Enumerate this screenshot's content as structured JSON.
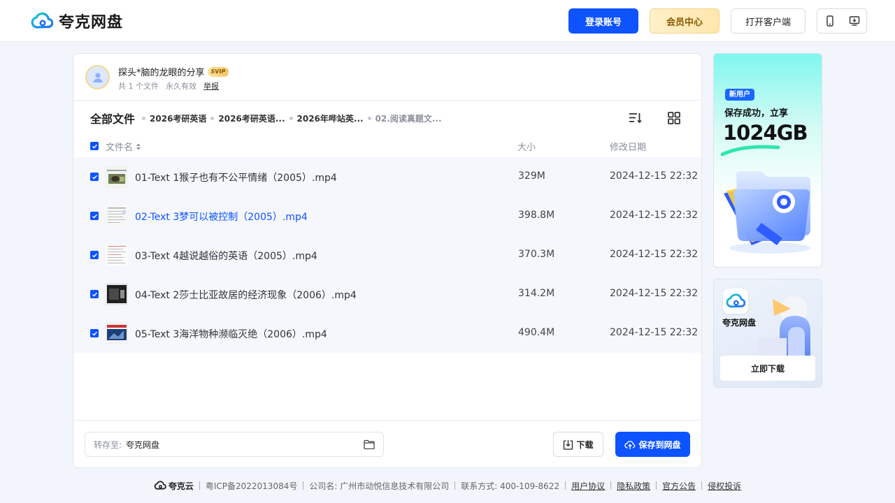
{
  "header": {
    "logo_text": "夸克网盘",
    "login_label": "登录账号",
    "vip_label": "会员中心",
    "client_label": "打开客户端"
  },
  "share": {
    "title": "探头*脑的龙眼的分享",
    "badge": "SVIP",
    "file_count": "共 1 个文件",
    "validity": "永久有效",
    "report": "举报"
  },
  "breadcrumb": {
    "root": "全部文件",
    "items": [
      "2026考研英语",
      "2026考研英语...",
      "2026年哔站英...",
      "02.阅读真题文..."
    ]
  },
  "columns": {
    "name": "文件名",
    "size": "大小",
    "date": "修改日期"
  },
  "files": [
    {
      "name": "01-Text 1猴子也有不公平情绪（2005）.mp4",
      "size": "329M",
      "date": "2024-12-15 22:32"
    },
    {
      "name": "02-Text 3梦可以被控制（2005）.mp4",
      "size": "398.8M",
      "date": "2024-12-15 22:32"
    },
    {
      "name": "03-Text 4越说越俗的英语（2005）.mp4",
      "size": "370.3M",
      "date": "2024-12-15 22:32"
    },
    {
      "name": "04-Text 2莎士比亚故居的经济现象（2006）.mp4",
      "size": "314.2M",
      "date": "2024-12-15 22:32"
    },
    {
      "name": "05-Text 3海洋物种濒临灭绝（2006）.mp4",
      "size": "490.4M",
      "date": "2024-12-15 22:32"
    }
  ],
  "save_bar": {
    "label": "转存至:",
    "value": "夸克网盘",
    "download": "下载",
    "save": "保存到网盘"
  },
  "ads": {
    "ad1_badge": "新用户",
    "ad1_line1": "保存成功，立享",
    "ad1_big": "1024GB",
    "ad2_name": "夸克网盘",
    "ad2_button": "立即下载"
  },
  "footer": {
    "brand": "夸克云",
    "icp": "粤ICP备2022013084号",
    "company": "公司名: 广州市动悦信息技术有限公司",
    "contact": "联系方式: 400-109-8622",
    "links": [
      "用户协议",
      "隐私政策",
      "官方公告",
      "侵权投诉"
    ]
  },
  "colors": {
    "primary": "#0d53ff",
    "page_bg": "#f2f5fb",
    "row_bg": "#f5f7fd"
  }
}
